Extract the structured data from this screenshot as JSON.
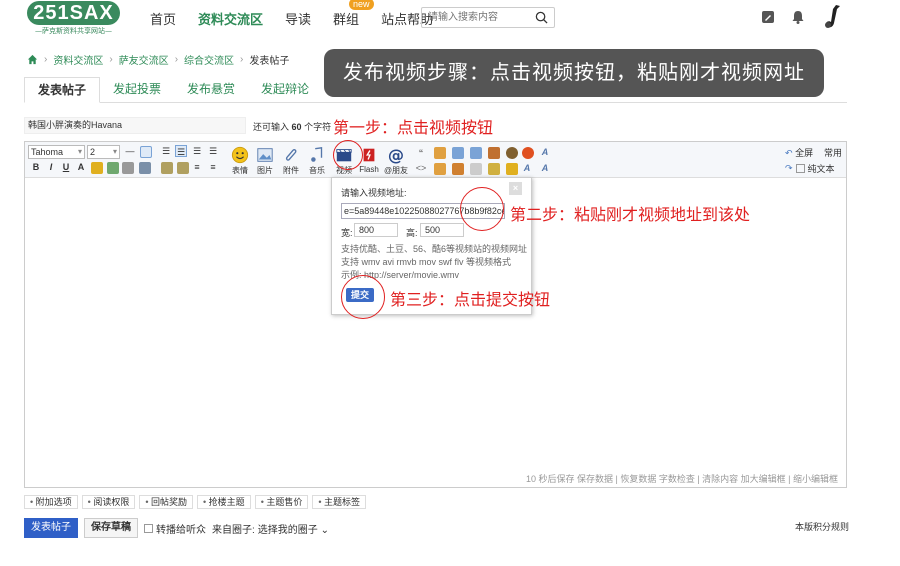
{
  "header": {
    "logo_text": "251SAX",
    "logo_sub": "—萨克斯资料共享网站—",
    "nav": [
      "首页",
      "资料交流区",
      "导读",
      "群组",
      "站点帮助"
    ],
    "nav_badge": "new",
    "search_placeholder": "请输入搜索内容"
  },
  "breadcrumb": [
    "资料交流区",
    "萨友交流区",
    "综合交流区",
    "发表帖子"
  ],
  "banner": "发布视频步骤：点击视频按钮，粘贴刚才视频网址",
  "tabs": [
    "发表帖子",
    "发起投票",
    "发布悬赏",
    "发起辩论"
  ],
  "subject": {
    "value": "韩国小胖演奏的Havana",
    "remain_prefix": "还可输入",
    "remain_count": "60",
    "remain_suffix": "个字符"
  },
  "toolbar": {
    "font": "Tahoma",
    "size": "2",
    "buttons": [
      "表情",
      "图片",
      "附件",
      "音乐",
      "视频",
      "Flash",
      "@朋友"
    ],
    "fullscreen": "全屏",
    "common": "常用",
    "plaintext": "纯文本"
  },
  "popup": {
    "title": "请输入视频地址:",
    "url_value": "e=5a89448e10225088027767b8b9f82ce9",
    "width_label": "宽:",
    "width_value": "800",
    "height_label": "高:",
    "height_value": "500",
    "hint1": "支持优酷、土豆、56、酷6等视频站的视频网址",
    "hint2": "支持 wmv avi rmvb mov swf flv 等视频格式",
    "hint3": "示例: http://server/movie.wmv",
    "submit": "提交",
    "close": "×"
  },
  "annotations": {
    "step1": "第一步：点击视频按钮",
    "step2": "第二步：粘贴刚才视频地址到该处",
    "step3": "第三步：点击提交按钮"
  },
  "editor_status": "10 秒后保存 保存数据 | 恢复数据    字数检查 | 清除内容    加大编辑框 | 缩小编辑框",
  "options": [
    "附加选项",
    "阅读权限",
    "回帖奖励",
    "抢楼主题",
    "主题售价",
    "主题标签"
  ],
  "bottom": {
    "post": "发表帖子",
    "draft": "保存草稿",
    "broadcast": "转播给听众",
    "circle_prefix": "来自圈子:",
    "circle_select": "选择我的圈子",
    "rules": "本版积分规则"
  },
  "colors": {
    "brand": "#3a8a5e",
    "link": "#2e8b57",
    "accent_red": "#e02020",
    "button_blue": "#2f5fc7"
  }
}
